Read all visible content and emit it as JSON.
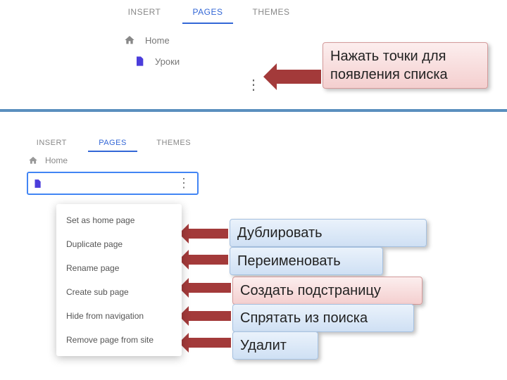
{
  "panel1": {
    "tabs": [
      "INSERT",
      "PAGES",
      "THEMES"
    ],
    "pages": [
      {
        "icon": "home",
        "label": "Home"
      },
      {
        "icon": "page",
        "label": "Уроки"
      }
    ]
  },
  "panel2": {
    "tabs": [
      "INSERT",
      "PAGES",
      "THEMES"
    ],
    "home": "Home"
  },
  "menu": [
    "Set as home page",
    "Duplicate page",
    "Rename page",
    "Create sub page",
    "Hide from navigation",
    "Remove page from site"
  ],
  "callouts": {
    "top": "Нажать точки для появления списка",
    "c1": "Дублировать",
    "c2": "Переименовать",
    "c3": "Создать подстраницу",
    "c4": "Спрятать из поиска",
    "c5": "Удалит"
  }
}
